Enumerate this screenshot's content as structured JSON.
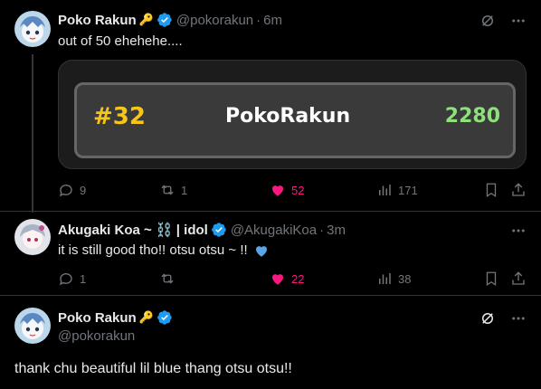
{
  "tweets": [
    {
      "name": "Poko Rakun",
      "emoji": "🔑",
      "handle": "@pokorakun",
      "time": "6m",
      "text": "out of 50 ehehehe....",
      "card": {
        "rank": "#32",
        "username": "PokoRakun",
        "score": "2280"
      },
      "replies": "9",
      "reposts": "1",
      "likes": "52",
      "views": "171"
    },
    {
      "name": "Akugaki Koa ~ ⛓️ | idol",
      "handle": "@AkugakiKoa",
      "time": "3m",
      "text": "it is still good tho!! otsu otsu ~ !!",
      "replies": "1",
      "reposts": "",
      "likes": "22",
      "views": "38"
    },
    {
      "name": "Poko Rakun",
      "emoji": "🔑",
      "handle": "@pokorakun",
      "text": "thank chu beautiful lil blue thang otsu otsu!!"
    }
  ],
  "colors": {
    "like": "#f91880",
    "verified": "#1d9bf0",
    "score": "#8ee07a",
    "rank": "#f5c518"
  }
}
